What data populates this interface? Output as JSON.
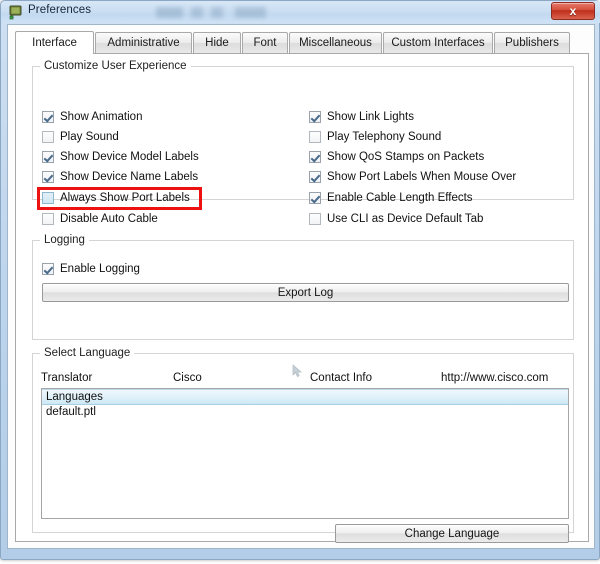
{
  "window": {
    "title": "Preferences",
    "icon": "app-icon",
    "close_label": "x"
  },
  "tabs": [
    {
      "label": "Interface",
      "active": true
    },
    {
      "label": "Administrative",
      "active": false
    },
    {
      "label": "Hide",
      "active": false
    },
    {
      "label": "Font",
      "active": false
    },
    {
      "label": "Miscellaneous",
      "active": false
    },
    {
      "label": "Custom Interfaces",
      "active": false
    },
    {
      "label": "Publishers",
      "active": false
    }
  ],
  "customize_group": {
    "title": "Customize User Experience",
    "left_column": [
      {
        "label": "Show Animation",
        "checked": true,
        "highlighted": false
      },
      {
        "label": "Play Sound",
        "checked": false,
        "highlighted": false
      },
      {
        "label": "Show Device Model Labels",
        "checked": true,
        "highlighted": false
      },
      {
        "label": "Show Device Name Labels",
        "checked": true,
        "highlighted": false
      },
      {
        "label": "Always Show Port Labels",
        "checked": false,
        "highlighted": true
      },
      {
        "label": "Disable Auto Cable",
        "checked": false,
        "highlighted": false
      }
    ],
    "right_column": [
      {
        "label": "Show Link Lights",
        "checked": true
      },
      {
        "label": "Play Telephony Sound",
        "checked": false
      },
      {
        "label": "Show QoS Stamps on Packets",
        "checked": true
      },
      {
        "label": "Show Port Labels When Mouse Over",
        "checked": true
      },
      {
        "label": "Enable Cable Length Effects",
        "checked": true
      },
      {
        "label": "Use CLI as Device Default Tab",
        "checked": false
      }
    ]
  },
  "logging_group": {
    "title": "Logging",
    "enable_logging": {
      "label": "Enable Logging",
      "checked": true
    },
    "export_button": "Export Log"
  },
  "language_group": {
    "title": "Select Language",
    "headers": [
      "Translator",
      "Cisco",
      "Contact Info",
      "http://www.cisco.com"
    ],
    "rows": [
      {
        "label": "Languages",
        "selected": true
      },
      {
        "label": "default.ptl",
        "selected": false
      }
    ],
    "change_button": "Change Language"
  },
  "colors": {
    "accent_red": "#ee1111",
    "titlebar": "#cbdff3",
    "selection": "#cbe8f5"
  }
}
